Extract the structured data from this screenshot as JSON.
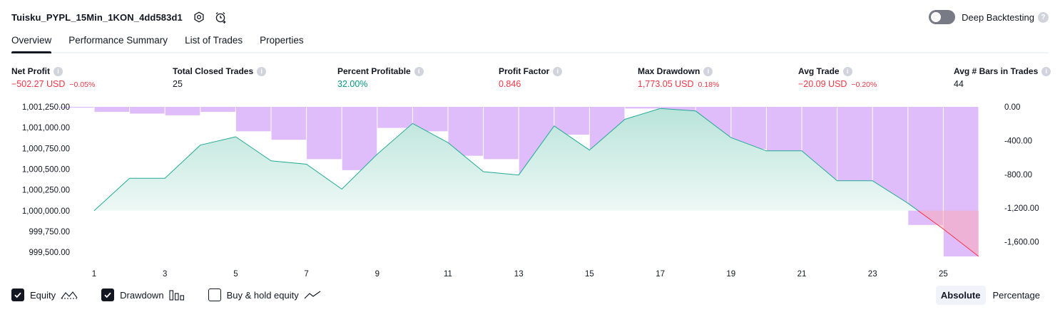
{
  "header": {
    "title": "Tuisku_PYPL_15Min_1KON_4dd583d1",
    "deep_backtesting_label": "Deep Backtesting",
    "deep_backtesting_enabled": false,
    "help_glyph": "?"
  },
  "tabs": [
    {
      "label": "Overview",
      "active": true
    },
    {
      "label": "Performance Summary",
      "active": false
    },
    {
      "label": "List of Trades",
      "active": false
    },
    {
      "label": "Properties",
      "active": false
    }
  ],
  "metrics": [
    {
      "label": "Net Profit",
      "value": "−502.27 USD",
      "pct": "−0.05%",
      "tone": "neg"
    },
    {
      "label": "Total Closed Trades",
      "value": "25",
      "pct": "",
      "tone": "plain"
    },
    {
      "label": "Percent Profitable",
      "value": "32.00%",
      "pct": "",
      "tone": "pos"
    },
    {
      "label": "Profit Factor",
      "value": "0.846",
      "pct": "",
      "tone": "neg"
    },
    {
      "label": "Max Drawdown",
      "value": "1,773.05 USD",
      "pct": "0.18%",
      "tone": "neg"
    },
    {
      "label": "Avg Trade",
      "value": "−20.09 USD",
      "pct": "−0.20%",
      "tone": "neg"
    },
    {
      "label": "Avg # Bars in Trades",
      "value": "44",
      "pct": "",
      "tone": "plain"
    }
  ],
  "chart_data": {
    "type": "area",
    "x_ticks": [
      "1",
      "3",
      "5",
      "7",
      "9",
      "11",
      "13",
      "15",
      "17",
      "19",
      "21",
      "23",
      "25"
    ],
    "left_axis": {
      "ticks": [
        "1,001,250.00",
        "1,001,000.00",
        "1,000,750.00",
        "1,000,500.00",
        "1,000,250.00",
        "1,000,000.00",
        "999,750.00",
        "999,500.00"
      ],
      "range": [
        999450,
        1001250
      ]
    },
    "right_axis": {
      "ticks": [
        "0.00",
        "-400.00",
        "-800.00",
        "-1,200.00",
        "-1,600.00"
      ],
      "range": [
        -1773.05,
        0
      ]
    },
    "series": [
      {
        "name": "Equity",
        "trades": [
          1,
          2,
          3,
          4,
          5,
          6,
          7,
          8,
          9,
          10,
          11,
          12,
          13,
          14,
          15,
          16,
          17,
          18,
          19,
          20,
          21,
          22,
          23,
          24,
          25,
          26
        ],
        "values": [
          1000000,
          1000390,
          1000390,
          1000790,
          1000890,
          1000600,
          1000560,
          1000260,
          1000680,
          1001050,
          1000820,
          1000470,
          1000430,
          1001020,
          1000730,
          1001100,
          1001230,
          1001200,
          1000880,
          1000720,
          1000720,
          1000360,
          1000360,
          1000090,
          999780,
          999450
        ]
      },
      {
        "name": "Drawdown",
        "trades": [
          1,
          2,
          3,
          4,
          5,
          6,
          7,
          8,
          9,
          10,
          11,
          12,
          13,
          14,
          15,
          16,
          17,
          18,
          19,
          20,
          21,
          22,
          23,
          24,
          25,
          26
        ],
        "values": [
          -10,
          -60,
          -80,
          -100,
          -60,
          -290,
          -390,
          -620,
          -750,
          -250,
          -290,
          -580,
          -620,
          -1000,
          -330,
          -500,
          -20,
          -140,
          -350,
          -500,
          -620,
          -1030,
          -920,
          -1130,
          -1400,
          -1773.05
        ]
      }
    ],
    "colors": {
      "equity_line": "#22ab94",
      "equity_fill_top": "#b9e4da",
      "equity_fill_bottom": "#eef8f5",
      "drawdown_bar": "#dfbdfb",
      "equity_below_initial_line": "#f23645",
      "equity_below_initial_fill": "#f7a9b7"
    }
  },
  "legend": [
    {
      "label": "Equity",
      "checked": true,
      "icon": "equity-line-icon"
    },
    {
      "label": "Drawdown",
      "checked": true,
      "icon": "drawdown-bars-icon"
    },
    {
      "label": "Buy & hold equity",
      "checked": false,
      "icon": "buy-hold-line-icon"
    }
  ],
  "mode_toggle": {
    "options": [
      "Absolute",
      "Percentage"
    ],
    "selected": "Absolute"
  }
}
